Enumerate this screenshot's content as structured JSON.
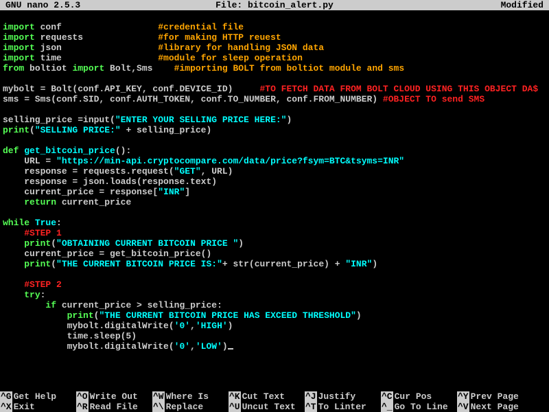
{
  "titlebar": {
    "app": "GNU nano 2.5.3",
    "file": "File: bitcoin_alert.py",
    "status": "Modified"
  },
  "code": [
    [],
    [
      [
        "g",
        "import"
      ],
      [
        "w",
        " conf                  "
      ],
      [
        "o",
        "#credential file"
      ]
    ],
    [
      [
        "g",
        "import"
      ],
      [
        "w",
        " requests              "
      ],
      [
        "o",
        "#for making HTTP reuest"
      ]
    ],
    [
      [
        "g",
        "import"
      ],
      [
        "w",
        " json                  "
      ],
      [
        "o",
        "#library for handling JSON data"
      ]
    ],
    [
      [
        "g",
        "import"
      ],
      [
        "w",
        " time                  "
      ],
      [
        "o",
        "#module for sleep operation"
      ]
    ],
    [
      [
        "g",
        "from"
      ],
      [
        "w",
        " boltiot "
      ],
      [
        "g",
        "import"
      ],
      [
        "w",
        " Bolt,Sms    "
      ],
      [
        "o",
        "#importing BOLT from boltiot module and sms"
      ]
    ],
    [],
    [
      [
        "w",
        "mybolt = Bolt(conf.API_KEY, conf.DEVICE_ID)     "
      ],
      [
        "r",
        "#TO FETCH DATA FROM BOLT CLOUD USING THIS OBJECT DA$"
      ]
    ],
    [
      [
        "w",
        "sms = Sms(conf.SID, conf.AUTH_TOKEN, conf.TO_NUMBER, conf.FROM_NUMBER) "
      ],
      [
        "r",
        "#OBJECT TO send SMS"
      ]
    ],
    [],
    [
      [
        "w",
        "selling_price =input("
      ],
      [
        "c",
        "\"ENTER YOUR SELLING PRICE HERE:\""
      ],
      [
        "w",
        ")"
      ]
    ],
    [
      [
        "g",
        "print"
      ],
      [
        "w",
        "("
      ],
      [
        "c",
        "\"SELLING PRICE:\""
      ],
      [
        "w",
        " + selling_price)"
      ]
    ],
    [],
    [
      [
        "g",
        "def"
      ],
      [
        "w",
        " "
      ],
      [
        "c",
        "get_bitcoin_price"
      ],
      [
        "w",
        "():"
      ]
    ],
    [
      [
        "w",
        "    URL = "
      ],
      [
        "c",
        "\"https://min-api.cryptocompare.com/data/price?fsym=BTC&tsyms=INR\""
      ]
    ],
    [
      [
        "w",
        "    response = requests.request("
      ],
      [
        "c",
        "\"GET\""
      ],
      [
        "w",
        ", URL)"
      ]
    ],
    [
      [
        "w",
        "    response = json.loads(response.text)"
      ]
    ],
    [
      [
        "w",
        "    current_price = response["
      ],
      [
        "c",
        "\"INR\""
      ],
      [
        "w",
        "]"
      ]
    ],
    [
      [
        "w",
        "    "
      ],
      [
        "g",
        "return"
      ],
      [
        "w",
        " current_price"
      ]
    ],
    [],
    [
      [
        "g",
        "while"
      ],
      [
        "w",
        " "
      ],
      [
        "c",
        "True"
      ],
      [
        "w",
        ":"
      ]
    ],
    [
      [
        "w",
        "    "
      ],
      [
        "r",
        "#STEP 1"
      ]
    ],
    [
      [
        "w",
        "    "
      ],
      [
        "g",
        "print"
      ],
      [
        "w",
        "("
      ],
      [
        "c",
        "\"OBTAINING CURRENT BITCOIN PRICE \""
      ],
      [
        "w",
        ")"
      ]
    ],
    [
      [
        "w",
        "    current_price = get_bitcoin_price()"
      ]
    ],
    [
      [
        "w",
        "    "
      ],
      [
        "g",
        "print"
      ],
      [
        "w",
        "("
      ],
      [
        "c",
        "\"THE CURRENT BITCOIN PRICE IS:\""
      ],
      [
        "w",
        "+ str(current_price) + "
      ],
      [
        "c",
        "\"INR\""
      ],
      [
        "w",
        ")"
      ]
    ],
    [],
    [
      [
        "w",
        "    "
      ],
      [
        "r",
        "#STEP 2"
      ]
    ],
    [
      [
        "w",
        "    "
      ],
      [
        "g",
        "try"
      ],
      [
        "w",
        ":"
      ]
    ],
    [
      [
        "w",
        "        "
      ],
      [
        "g",
        "if"
      ],
      [
        "w",
        " current_price > selling_price:"
      ]
    ],
    [
      [
        "w",
        "            "
      ],
      [
        "g",
        "print"
      ],
      [
        "w",
        "("
      ],
      [
        "c",
        "\"THE CURRENT BITCOIN PRICE HAS EXCEED THRESHOLD\""
      ],
      [
        "w",
        ")"
      ]
    ],
    [
      [
        "w",
        "            mybolt.digitalWrite("
      ],
      [
        "c",
        "'0'"
      ],
      [
        "w",
        ","
      ],
      [
        "c",
        "'HIGH'"
      ],
      [
        "w",
        ")"
      ]
    ],
    [
      [
        "w",
        "            time.sleep(5)"
      ]
    ],
    [
      [
        "w",
        "            mybolt.digitalWrite("
      ],
      [
        "c",
        "'0'"
      ],
      [
        "w",
        ","
      ],
      [
        "c",
        "'LOW'"
      ],
      [
        "w",
        ")"
      ]
    ]
  ],
  "menu": [
    {
      "key": "^G",
      "label": "Get Help"
    },
    {
      "key": "^O",
      "label": "Write Out"
    },
    {
      "key": "^W",
      "label": "Where Is"
    },
    {
      "key": "^K",
      "label": "Cut Text"
    },
    {
      "key": "^J",
      "label": "Justify"
    },
    {
      "key": "^C",
      "label": "Cur Pos"
    },
    {
      "key": "^Y",
      "label": "Prev Page"
    },
    {
      "key": "^X",
      "label": "Exit"
    },
    {
      "key": "^R",
      "label": "Read File"
    },
    {
      "key": "^\\",
      "label": "Replace"
    },
    {
      "key": "^U",
      "label": "Uncut Text"
    },
    {
      "key": "^T",
      "label": "To Linter"
    },
    {
      "key": "^_",
      "label": "Go To Line"
    },
    {
      "key": "^V",
      "label": "Next Page"
    }
  ]
}
